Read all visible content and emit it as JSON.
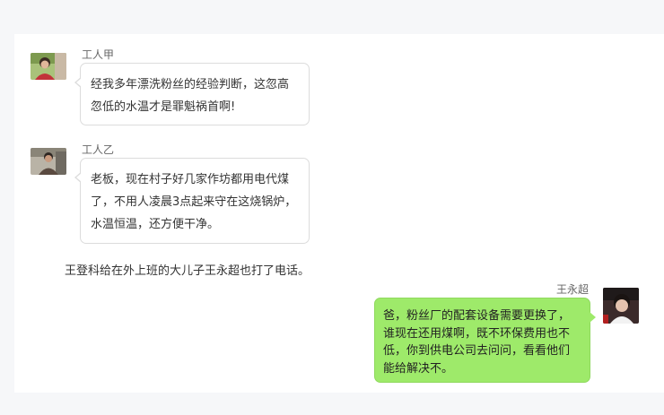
{
  "messages": [
    {
      "sender": "工人甲",
      "text": "经我多年漂洗粉丝的经验判断，这忽高忽低的水温才是罪魁祸首啊!",
      "side": "left"
    },
    {
      "sender": "工人乙",
      "text": "老板，现在村子好几家作坊都用电代煤了，不用人凌晨3点起来守在这烧锅炉，水温恒温，还方便干净。",
      "side": "left"
    },
    {
      "sender": "王永超",
      "text": "爸，粉丝厂的配套设备需要更换了，谁现在还用煤啊，既不环保费用也不低，你到供电公司去问问，看看他们能给解决不。",
      "side": "right"
    }
  ],
  "narration": "王登科给在外上班的大儿子王永超也打了电话。",
  "colors": {
    "page_background": "#f6f7f9",
    "panel_background": "#ffffff",
    "left_bubble": "#ffffff",
    "right_bubble": "#9eea6a"
  }
}
